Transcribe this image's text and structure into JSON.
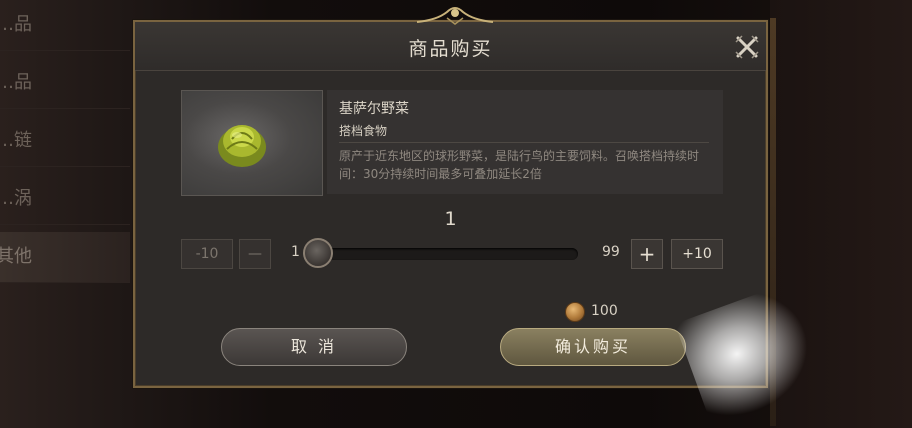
{
  "background": {
    "tabs": [
      {
        "label": "…品"
      },
      {
        "label": "…品"
      },
      {
        "label": "…链"
      },
      {
        "label": "…涡"
      },
      {
        "label": "其他"
      }
    ]
  },
  "dialog": {
    "title": "商品购买",
    "close_icon": "close-x-icon"
  },
  "item": {
    "icon": "cabbage-icon",
    "name": "基萨尔野菜",
    "type": "搭档食物",
    "description": "原产于近东地区的球形野菜，是陆行鸟的主要饲料。召唤搭档持续时间：30分持续时间最多可叠加延长2倍"
  },
  "quantity": {
    "current": "1",
    "min": "1",
    "max": "99",
    "minus_ten_label": "-10",
    "minus_label": "—",
    "plus_label": "+",
    "plus_ten_label": "+10",
    "slider_fraction": 0
  },
  "price": {
    "icon": "coin-icon",
    "value": "100"
  },
  "buttons": {
    "cancel_label": "取 消",
    "confirm_label": "确认购买"
  },
  "colors": {
    "frame_gold": "#7a6440",
    "confirm_button": "#8a8060",
    "cancel_button": "#5a5552"
  }
}
